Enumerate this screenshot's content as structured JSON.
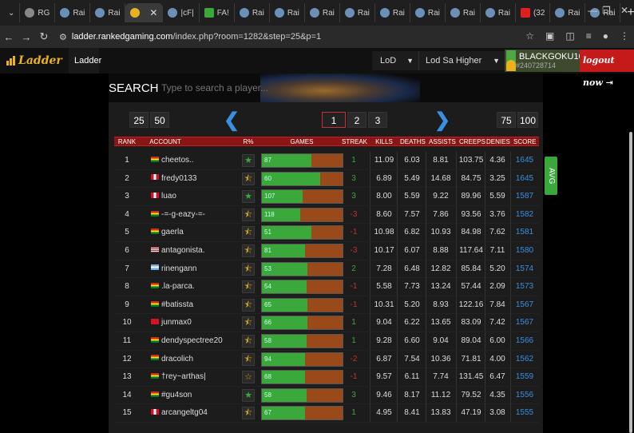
{
  "browser": {
    "tabs": [
      {
        "label": "RG"
      },
      {
        "label": "Rai"
      },
      {
        "label": "Rai"
      },
      {
        "label": "",
        "active": true
      },
      {
        "label": "|cF|"
      },
      {
        "label": "FA!"
      },
      {
        "label": "Rai"
      },
      {
        "label": "Rai"
      },
      {
        "label": "Rai"
      },
      {
        "label": "Rai"
      },
      {
        "label": "Rai"
      },
      {
        "label": "Rai"
      },
      {
        "label": "Rai"
      },
      {
        "label": "Rai"
      },
      {
        "label": "(32"
      },
      {
        "label": "Rai"
      },
      {
        "label": "Rai"
      }
    ],
    "url_host": "ladder.rankedgaming.com",
    "url_path": "/index.php?room=1282&step=25&p=1"
  },
  "site": {
    "logo_text": "Ladder",
    "nav_ladder": "Ladder",
    "game_select": "LoD",
    "room_select": "Lod Sa Higher",
    "username": "BLACKGOKU10",
    "user_id": "#240728714",
    "logout_label": "logout now",
    "search_title": "SEARCH",
    "search_placeholder": "Type to search a player..."
  },
  "pager": {
    "step_options": [
      "25",
      "50"
    ],
    "pages": [
      "1",
      "2",
      "3"
    ],
    "current_page": "1",
    "right_options": [
      "75",
      "100"
    ]
  },
  "table": {
    "headers": {
      "rank": "RANK",
      "account": "ACCOUNT",
      "r": "R%",
      "games": "GAMES",
      "streak": "STREAK",
      "kills": "KILLS",
      "deaths": "DEATHS",
      "assists": "ASSISTS",
      "creeps": "CREEPS",
      "denies": "DENIES",
      "score": "SCORE"
    },
    "avg_label": "AVG",
    "rows": [
      {
        "rank": "1",
        "flag": "bo",
        "name": "cheetos..",
        "star": "full",
        "games": "87",
        "win_frac": 0.61,
        "streak": "1",
        "kills": "11.09",
        "deaths": "6.03",
        "assists": "8.81",
        "creeps": "103.75",
        "denies": "4.36",
        "score": "1645"
      },
      {
        "rank": "2",
        "flag": "pe",
        "name": "fredy0133",
        "star": "half",
        "games": "60",
        "win_frac": 0.72,
        "streak": "3",
        "kills": "6.89",
        "deaths": "5.49",
        "assists": "14.68",
        "creeps": "84.75",
        "denies": "3.25",
        "score": "1645"
      },
      {
        "rank": "3",
        "flag": "pe",
        "name": "luao",
        "star": "full",
        "games": "107",
        "win_frac": 0.5,
        "streak": "3",
        "kills": "8.00",
        "deaths": "5.59",
        "assists": "9.22",
        "creeps": "89.96",
        "denies": "5.59",
        "score": "1587"
      },
      {
        "rank": "4",
        "flag": "bo",
        "name": "-=-g-eazy-=-",
        "star": "half",
        "games": "118",
        "win_frac": 0.48,
        "streak": "-3",
        "kills": "8.60",
        "deaths": "7.57",
        "assists": "7.86",
        "creeps": "93.56",
        "denies": "3.76",
        "score": "1582"
      },
      {
        "rank": "5",
        "flag": "bo",
        "name": "gaerla",
        "star": "half",
        "games": "51",
        "win_frac": 0.61,
        "streak": "-1",
        "kills": "10.98",
        "deaths": "6.82",
        "assists": "10.93",
        "creeps": "84.98",
        "denies": "7.62",
        "score": "1581"
      },
      {
        "rank": "6",
        "flag": "us",
        "name": "antagonista.",
        "star": "half",
        "games": "81",
        "win_frac": 0.53,
        "streak": "-3",
        "kills": "10.17",
        "deaths": "6.07",
        "assists": "8.88",
        "creeps": "117.64",
        "denies": "7.11",
        "score": "1580"
      },
      {
        "rank": "7",
        "flag": "ar",
        "name": "rinengann",
        "star": "half",
        "games": "53",
        "win_frac": 0.56,
        "streak": "2",
        "kills": "7.28",
        "deaths": "6.48",
        "assists": "12.82",
        "creeps": "85.84",
        "denies": "5.20",
        "score": "1574"
      },
      {
        "rank": "8",
        "flag": "bo",
        "name": ".la-parca.",
        "star": "half",
        "games": "54",
        "win_frac": 0.55,
        "streak": "-1",
        "kills": "5.58",
        "deaths": "7.73",
        "assists": "13.24",
        "creeps": "57.44",
        "denies": "2.09",
        "score": "1573"
      },
      {
        "rank": "9",
        "flag": "bo",
        "name": "#batissta",
        "star": "half",
        "games": "65",
        "win_frac": 0.56,
        "streak": "-1",
        "kills": "10.31",
        "deaths": "5.20",
        "assists": "8.93",
        "creeps": "122.16",
        "denies": "7.84",
        "score": "1567"
      },
      {
        "rank": "10",
        "flag": "pe2",
        "name": "junmax0",
        "star": "half",
        "games": "66",
        "win_frac": 0.56,
        "streak": "1",
        "kills": "9.04",
        "deaths": "6.22",
        "assists": "13.65",
        "creeps": "83.09",
        "denies": "7.42",
        "score": "1567"
      },
      {
        "rank": "11",
        "flag": "bo",
        "name": "dendyspectree20",
        "star": "half",
        "games": "58",
        "win_frac": 0.55,
        "streak": "1",
        "kills": "9.28",
        "deaths": "6.60",
        "assists": "9.04",
        "creeps": "89.04",
        "denies": "6.00",
        "score": "1566"
      },
      {
        "rank": "12",
        "flag": "bo",
        "name": "dracolich",
        "star": "half",
        "games": "94",
        "win_frac": 0.53,
        "streak": "-2",
        "kills": "6.87",
        "deaths": "7.54",
        "assists": "10.36",
        "creeps": "71.81",
        "denies": "4.00",
        "score": "1562"
      },
      {
        "rank": "13",
        "flag": "bo",
        "name": "†rey~arthas|",
        "star": "empty",
        "games": "68",
        "win_frac": 0.53,
        "streak": "-1",
        "kills": "9.57",
        "deaths": "6.11",
        "assists": "7.74",
        "creeps": "131.45",
        "denies": "6.47",
        "score": "1559"
      },
      {
        "rank": "14",
        "flag": "bo",
        "name": "#gu4son",
        "star": "full",
        "games": "58",
        "win_frac": 0.55,
        "streak": "3",
        "kills": "9.46",
        "deaths": "8.17",
        "assists": "11.12",
        "creeps": "79.52",
        "denies": "4.35",
        "score": "1556"
      },
      {
        "rank": "15",
        "flag": "pe",
        "name": "arcangeltg04",
        "star": "half",
        "games": "67",
        "win_frac": 0.53,
        "streak": "1",
        "kills": "4.95",
        "deaths": "8.41",
        "assists": "13.83",
        "creeps": "47.19",
        "denies": "3.08",
        "score": "1555"
      }
    ]
  },
  "colors": {
    "accent_red": "#8b1515",
    "win_green": "#3aa83a",
    "loss_orange": "#9a4a1a",
    "score_blue": "#3a8fe0",
    "positive_streak": "#3aa83a",
    "negative_streak": "#c53030"
  }
}
